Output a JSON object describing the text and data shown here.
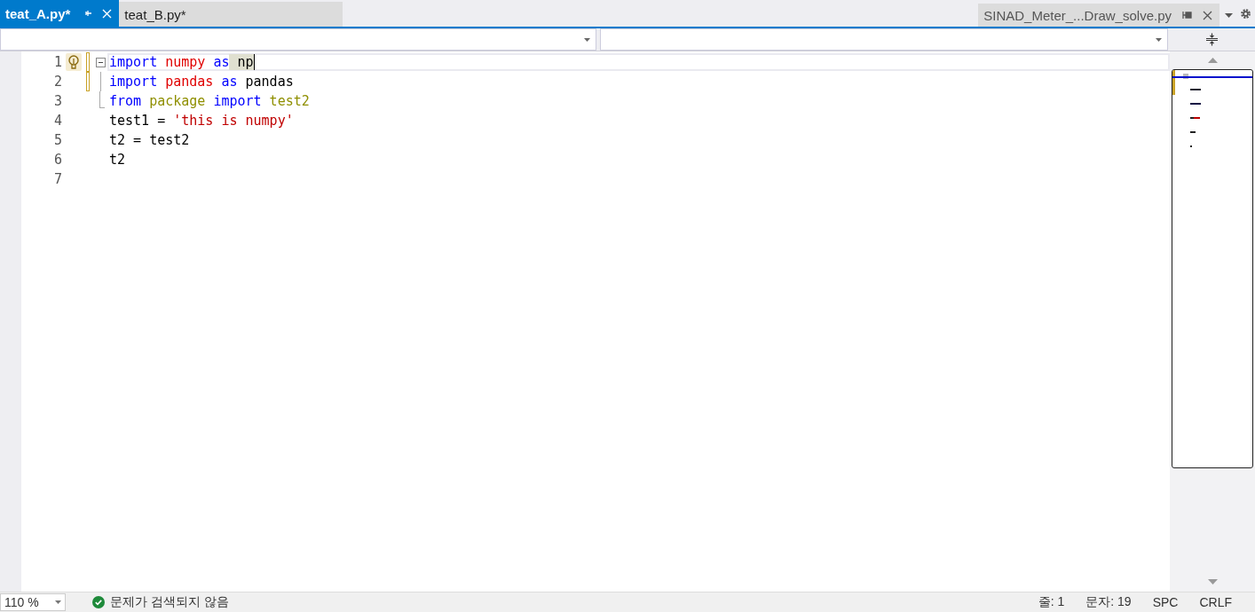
{
  "tabs": [
    {
      "label": "teat_A.py*",
      "selected": true
    },
    {
      "label": "teat_B.py*",
      "selected": false
    }
  ],
  "preview_tab": {
    "label": "SINAD_Meter_...Draw_solve.py"
  },
  "editor": {
    "lines": [
      {
        "number": "1",
        "current": true,
        "changed": true,
        "lightbulb": true,
        "fold_start": true,
        "fold_member": false,
        "tokens": [
          {
            "text": "import",
            "kind": "keyword"
          },
          {
            "text": " numpy",
            "kind": "module"
          },
          {
            "text": " as",
            "kind": "keyword"
          },
          {
            "text": " np",
            "kind": "highlight"
          }
        ]
      },
      {
        "number": "2",
        "current": false,
        "changed": true,
        "lightbulb": false,
        "fold_start": false,
        "fold_member": true,
        "tokens": [
          {
            "text": "import",
            "kind": "keyword"
          },
          {
            "text": " pandas",
            "kind": "module"
          },
          {
            "text": " as",
            "kind": "keyword"
          },
          {
            "text": " pandas",
            "kind": "plain"
          }
        ]
      },
      {
        "number": "3",
        "current": false,
        "changed": false,
        "lightbulb": false,
        "fold_start": false,
        "fold_member": true,
        "tokens": [
          {
            "text": "from",
            "kind": "keyword"
          },
          {
            "text": " package",
            "kind": "unresolved"
          },
          {
            "text": " import",
            "kind": "keyword"
          },
          {
            "text": " test2",
            "kind": "unresolved"
          }
        ]
      },
      {
        "number": "4",
        "current": false,
        "changed": false,
        "lightbulb": false,
        "fold_start": false,
        "fold_member": false,
        "tokens": [
          {
            "text": "test1 =",
            "kind": "plain"
          },
          {
            "text": " 'this is numpy'",
            "kind": "string"
          }
        ]
      },
      {
        "number": "5",
        "current": false,
        "changed": false,
        "lightbulb": false,
        "fold_start": false,
        "fold_member": false,
        "tokens": [
          {
            "text": "t2 = test2",
            "kind": "plain"
          }
        ]
      },
      {
        "number": "6",
        "current": false,
        "changed": false,
        "lightbulb": false,
        "fold_start": false,
        "fold_member": false,
        "tokens": [
          {
            "text": "t2",
            "kind": "plain"
          }
        ]
      },
      {
        "number": "7",
        "current": false,
        "changed": false,
        "lightbulb": false,
        "fold_start": false,
        "fold_member": false
      }
    ]
  },
  "status_bar": {
    "zoom": "110 %",
    "issues": "문제가 검색되지 않음",
    "line": "줄: 1",
    "column": "문자: 19",
    "indent": "SPC",
    "line_ending": "CRLF"
  }
}
